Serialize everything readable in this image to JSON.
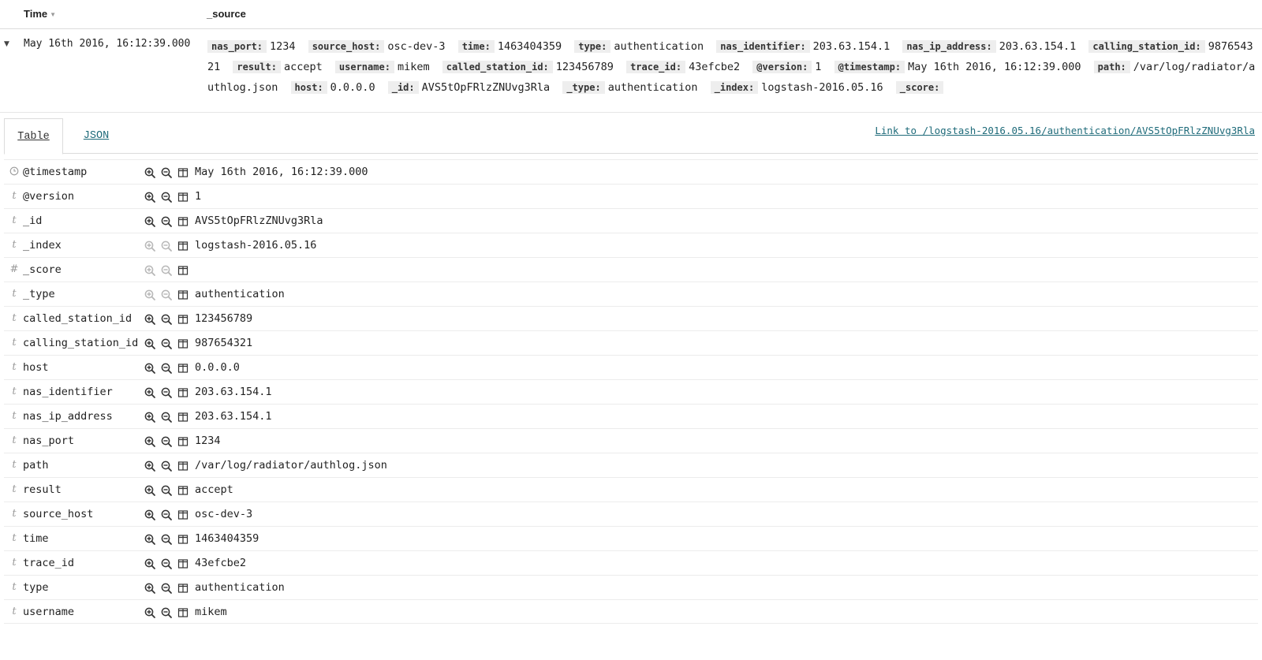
{
  "header": {
    "time_label": "Time",
    "source_label": "_source"
  },
  "document_row": {
    "timestamp": "May 16th 2016, 16:12:39.000",
    "summary_pairs": [
      {
        "key": "nas_port:",
        "value": "1234"
      },
      {
        "key": "source_host:",
        "value": "osc-dev-3"
      },
      {
        "key": "time:",
        "value": "1463404359"
      },
      {
        "key": "type:",
        "value": "authentication"
      },
      {
        "key": "nas_identifier:",
        "value": "203.63.154.1"
      },
      {
        "key": "nas_ip_address:",
        "value": "203.63.154.1"
      },
      {
        "key": "calling_station_id:",
        "value": "987654321"
      },
      {
        "key": "result:",
        "value": "accept"
      },
      {
        "key": "username:",
        "value": "mikem"
      },
      {
        "key": "called_station_id:",
        "value": "123456789"
      },
      {
        "key": "trace_id:",
        "value": "43efcbe2"
      },
      {
        "key": "@version:",
        "value": "1"
      },
      {
        "key": "@timestamp:",
        "value": "May 16th 2016, 16:12:39.000"
      },
      {
        "key": "path:",
        "value": "/var/log/radiator/authlog.json"
      },
      {
        "key": "host:",
        "value": "0.0.0.0"
      },
      {
        "key": "_id:",
        "value": "AVS5tOpFRlzZNUvg3Rla"
      },
      {
        "key": "_type:",
        "value": "authentication"
      },
      {
        "key": "_index:",
        "value": "logstash-2016.05.16"
      },
      {
        "key": "_score:",
        "value": ""
      }
    ]
  },
  "tabs": {
    "table": "Table",
    "json": "JSON"
  },
  "permalink": "Link to /logstash-2016.05.16/authentication/AVS5tOpFRlzZNUvg3Rla",
  "fields": [
    {
      "type": "clock",
      "name": "@timestamp",
      "value": "May 16th 2016, 16:12:39.000",
      "filterable": true
    },
    {
      "type": "t",
      "name": "@version",
      "value": "1",
      "filterable": true
    },
    {
      "type": "t",
      "name": "_id",
      "value": "AVS5tOpFRlzZNUvg3Rla",
      "filterable": true
    },
    {
      "type": "t",
      "name": "_index",
      "value": "logstash-2016.05.16",
      "filterable": false
    },
    {
      "type": "#",
      "name": "_score",
      "value": "",
      "filterable": false
    },
    {
      "type": "t",
      "name": "_type",
      "value": "authentication",
      "filterable": false
    },
    {
      "type": "t",
      "name": "called_station_id",
      "value": "123456789",
      "filterable": true
    },
    {
      "type": "t",
      "name": "calling_station_id",
      "value": "987654321",
      "filterable": true
    },
    {
      "type": "t",
      "name": "host",
      "value": "0.0.0.0",
      "filterable": true
    },
    {
      "type": "t",
      "name": "nas_identifier",
      "value": "203.63.154.1",
      "filterable": true
    },
    {
      "type": "t",
      "name": "nas_ip_address",
      "value": "203.63.154.1",
      "filterable": true
    },
    {
      "type": "t",
      "name": "nas_port",
      "value": "1234",
      "filterable": true
    },
    {
      "type": "t",
      "name": "path",
      "value": "/var/log/radiator/authlog.json",
      "filterable": true
    },
    {
      "type": "t",
      "name": "result",
      "value": "accept",
      "filterable": true
    },
    {
      "type": "t",
      "name": "source_host",
      "value": "osc-dev-3",
      "filterable": true
    },
    {
      "type": "t",
      "name": "time",
      "value": "1463404359",
      "filterable": true
    },
    {
      "type": "t",
      "name": "trace_id",
      "value": "43efcbe2",
      "filterable": true
    },
    {
      "type": "t",
      "name": "type",
      "value": "authentication",
      "filterable": true
    },
    {
      "type": "t",
      "name": "username",
      "value": "mikem",
      "filterable": true
    }
  ],
  "icons": {
    "expand": "chevron-down-icon",
    "sort": "sort-down-icon",
    "clock": "clock-icon",
    "filter_for": "zoom-in-icon",
    "filter_out": "zoom-out-icon",
    "toggle_column": "table-column-icon"
  },
  "colors": {
    "link": "#1f6b7a",
    "key_bg": "#eeeeee",
    "muted": "#9a9a9a"
  }
}
